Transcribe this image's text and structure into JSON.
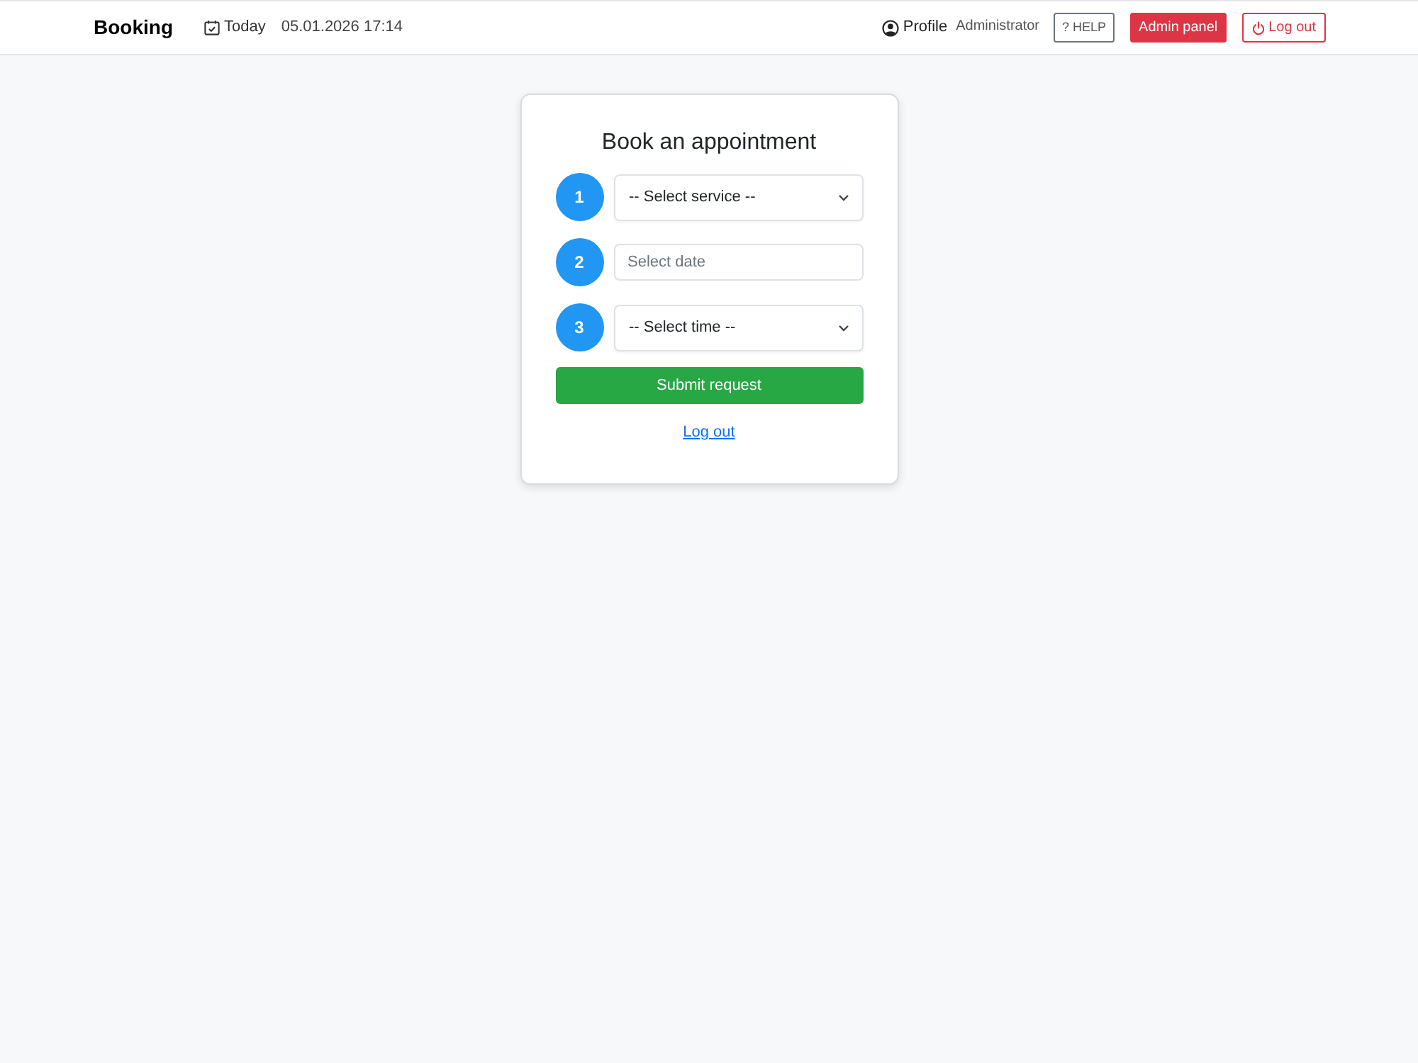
{
  "navbar": {
    "brand": "Booking",
    "today_label": "Today",
    "datetime": "05.01.2026 17:14",
    "profile_label": "Profile",
    "role": "Administrator",
    "help_button": "? HELP",
    "admin_button": "Admin panel",
    "logout_button": "Log out"
  },
  "form": {
    "title": "Book an appointment",
    "steps": [
      {
        "number": "1",
        "kind": "select",
        "value": "-- Select service --"
      },
      {
        "number": "2",
        "kind": "input",
        "placeholder": "Select date"
      },
      {
        "number": "3",
        "kind": "select",
        "value": "-- Select time --"
      }
    ],
    "submit_button": "Submit request",
    "logout_link": "Log out"
  }
}
